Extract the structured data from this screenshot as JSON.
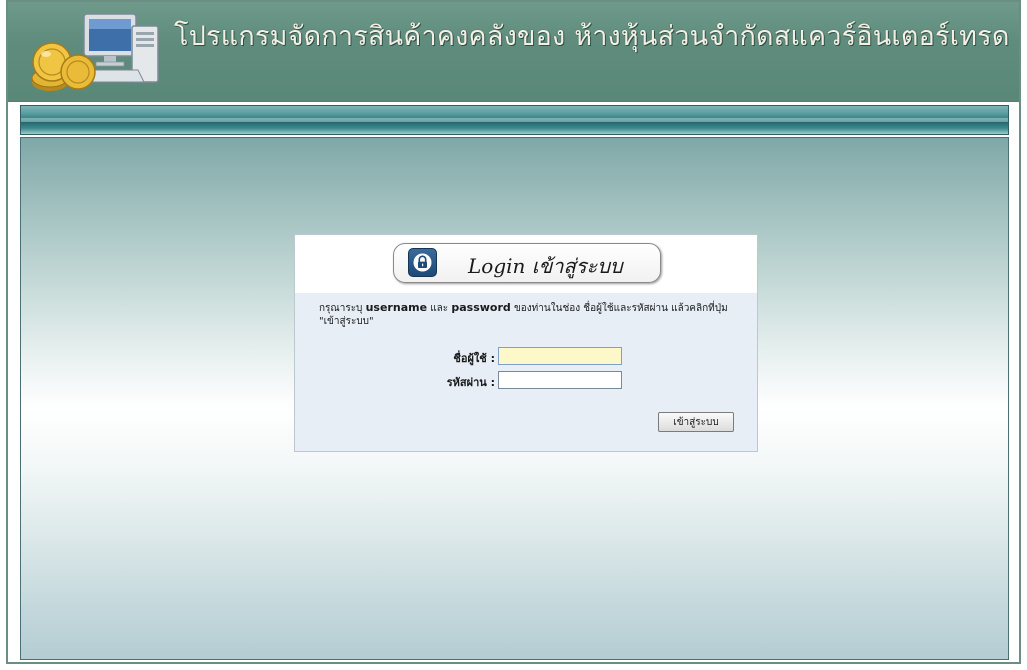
{
  "header": {
    "title": "โปรแกรมจัดการสินค้าคงคลังของ ห้างหุ้นส่วนจำกัดสแควร์อินเตอร์เทรด",
    "logo_icon": "computer-with-gold-coins-icon"
  },
  "login": {
    "heading": "Login เข้าสู่ระบบ",
    "lock_icon": "lock-icon",
    "instructions": {
      "part1": "กรุณาระบุ ",
      "username_word": "username",
      "part2": " และ ",
      "password_word": "password",
      "part3": " ของท่านในช่อง ชื่อผู้ใช้และรหัสผ่าน แล้วคลิกที่ปุ่ม \"เข้าสู่ระบบ\""
    },
    "username_label": "ชื่อผู้ใช้ :",
    "username_value": "",
    "password_label": "รหัสผ่าน :",
    "password_value": "",
    "submit_label": "เข้าสู่ระบบ"
  },
  "colors": {
    "header_bg": "#5f8c7d",
    "title_text": "#f4efe4",
    "navbar_bg": "#2f7a80",
    "active_input_bg": "#fcf8c9",
    "login_panel_bg": "#e7eef6"
  }
}
